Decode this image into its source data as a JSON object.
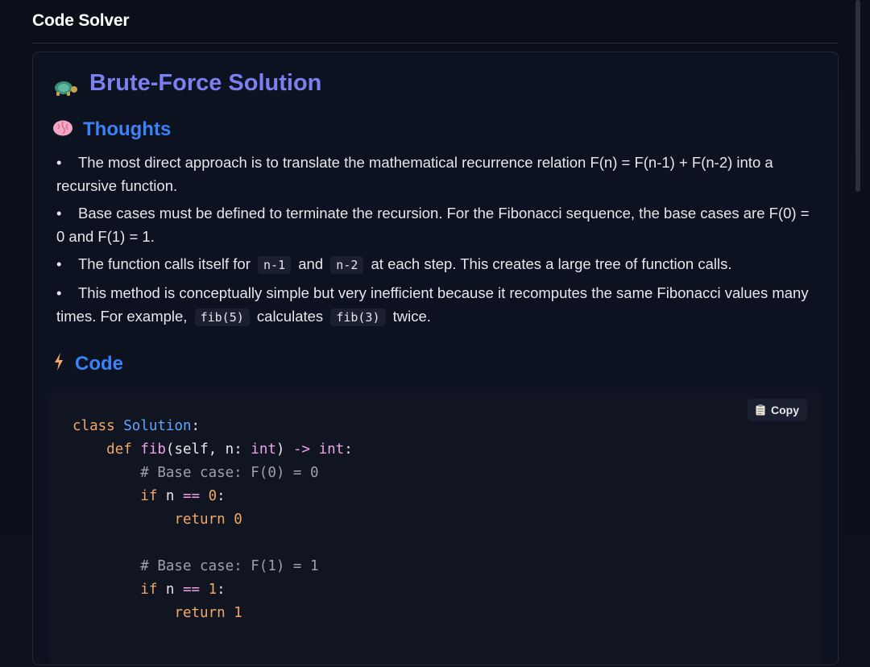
{
  "app": {
    "title": "Code Solver"
  },
  "section": {
    "title": "Brute-Force Solution",
    "icon": "turtle-icon"
  },
  "thoughts": {
    "heading": "Thoughts",
    "icon": "brain-icon",
    "bullets": [
      {
        "parts": [
          "The most direct approach is to translate the mathematical recurrence relation F(n) = F(n-1) + F(n-2) into a recursive function."
        ]
      },
      {
        "parts": [
          "Base cases must be defined to terminate the recursion. For the Fibonacci sequence, the base cases are F(0) = 0 and F(1) = 1."
        ]
      },
      {
        "parts": [
          "The function calls itself for",
          "n-1",
          "and",
          "n-2",
          "at each step. This creates a large tree of function calls."
        ]
      },
      {
        "parts": [
          "This method is conceptually simple but very inefficient because it recomputes the same Fibonacci values many times. For example,",
          "fib(5)",
          "calculates",
          "fib(3)",
          "twice."
        ]
      }
    ]
  },
  "code": {
    "heading": "Code",
    "icon": "lightning-icon",
    "copy_label": "Copy",
    "copy_icon": "clipboard-icon",
    "lines": [
      "class Solution:",
      "    def fib(self, n: int) -> int:",
      "        # Base case: F(0) = 0",
      "        if n == 0:",
      "            return 0",
      "",
      "        # Base case: F(1) = 1",
      "        if n == 1:",
      "            return 1"
    ]
  }
}
